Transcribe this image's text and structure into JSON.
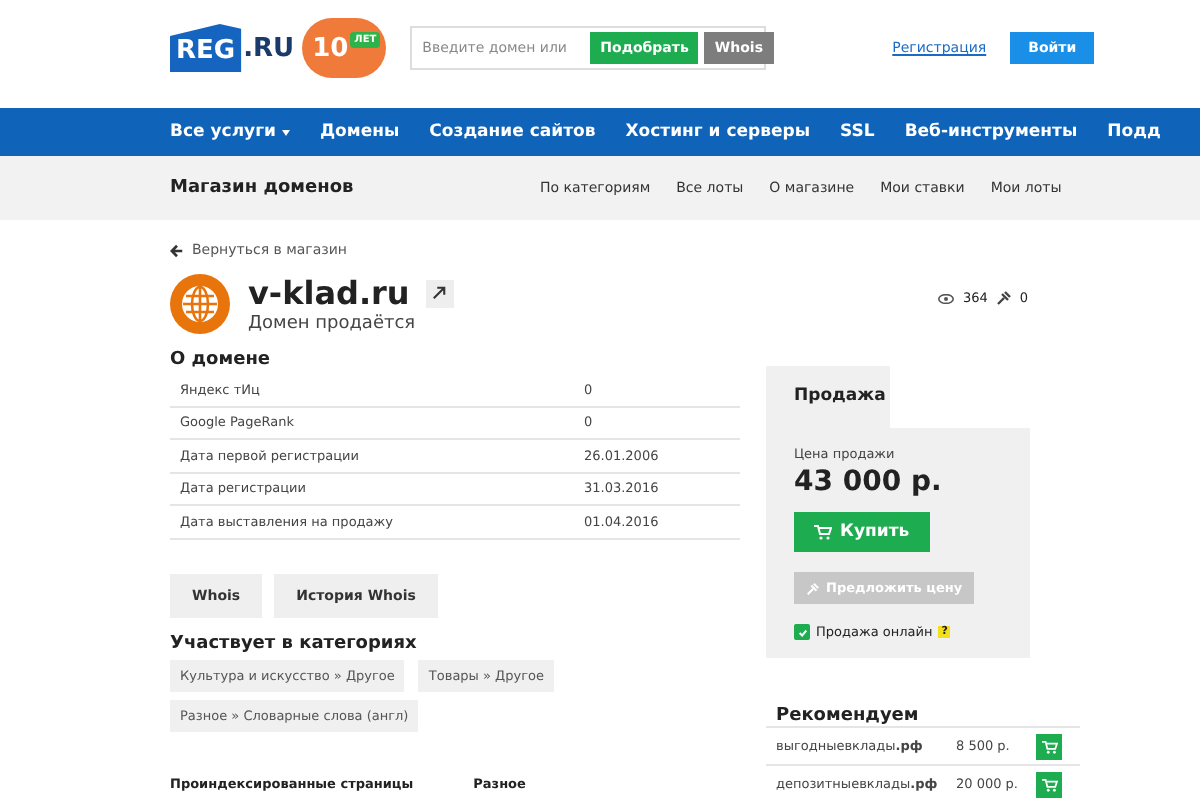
{
  "header": {
    "logo": "REG",
    "logo_suffix": ".RU",
    "anniversary": "10",
    "anniversary_label": "ЛЕТ",
    "search": {
      "placeholder": "Введите домен или"
    },
    "pick_button": "Подобрать",
    "whois_button": "Whois",
    "register_link": "Регистрация",
    "login_button": "Войти"
  },
  "nav": [
    {
      "label": "Все услуги",
      "dropdown": true
    },
    {
      "label": "Домены",
      "dropdown": false
    },
    {
      "label": "Создание сайтов",
      "dropdown": false
    },
    {
      "label": "Хостинг и серверы",
      "dropdown": false
    },
    {
      "label": "SSL",
      "dropdown": false
    },
    {
      "label": "Веб-инструменты",
      "dropdown": false
    },
    {
      "label": "Подд",
      "dropdown": false
    }
  ],
  "subnav": {
    "title": "Магазин доменов",
    "links": [
      "По категориям",
      "Все лоты",
      "О магазине",
      "Мои ставки",
      "Мои лоты"
    ]
  },
  "back_link": "Вернуться в магазин",
  "domain": {
    "name": "v-klad.ru",
    "status": "Домен продаётся",
    "views": "364",
    "bids": "0"
  },
  "about": {
    "title": "О домене",
    "rows": [
      {
        "label": "Яндекс тИц",
        "value": "0"
      },
      {
        "label": "Google PageRank",
        "value": "0"
      },
      {
        "label": "Дата первой регистрации",
        "value": "26.01.2006"
      },
      {
        "label": "Дата регистрации",
        "value": "31.03.2016"
      },
      {
        "label": "Дата выставления на продажу",
        "value": "01.04.2016"
      }
    ]
  },
  "buttons": [
    "Whois",
    "История Whois"
  ],
  "categories": {
    "title": "Участвует в категориях",
    "tags": [
      "Культура и искусство » Другое",
      "Товары » Другое",
      "Разное » Словарные слова (англ)"
    ]
  },
  "bottom_headings": [
    "Проиндексированные страницы",
    "Разное"
  ],
  "sale": {
    "tab": "Продажа",
    "price_label": "Цена продажи",
    "price": "43 000 р.",
    "buy_button": "Купить",
    "offer_button": "Предложить цену",
    "offer_disabled": true,
    "online_label": "Продажа онлайн",
    "online_checked": true,
    "help": "?"
  },
  "recommend": {
    "title": "Рекомендуем",
    "rows": [
      {
        "domain": "выгодныевклады**.рф**",
        "price": "8 500 р."
      },
      {
        "domain": "депозитныевклады**.рф**",
        "price": "20 000 р."
      }
    ]
  }
}
